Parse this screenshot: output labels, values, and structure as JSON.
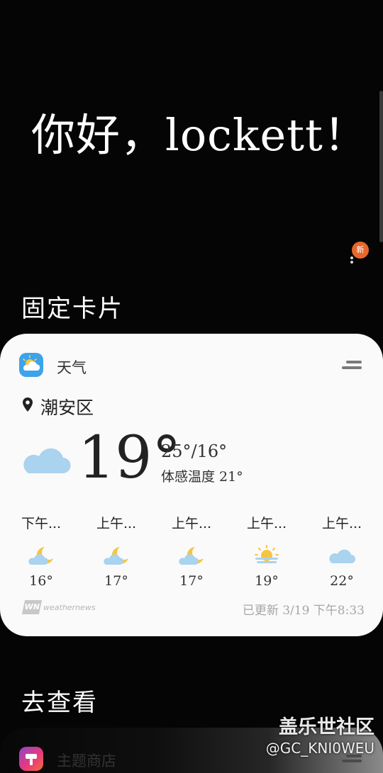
{
  "greeting": "你好，lockett！",
  "menu": {
    "badge": "新",
    "icon": "more-vertical-icon"
  },
  "pinned_section": {
    "title": "固定卡片",
    "weather": {
      "app_name": "天气",
      "app_icon": "weather-app-icon",
      "location": "潮安区",
      "current": {
        "condition": "cloudy",
        "temperature": "19°",
        "range": "25°/16°",
        "feels_like": "体感温度 21°"
      },
      "forecast": [
        {
          "time": "下午...",
          "condition": "cloudy-night",
          "temp": "16°"
        },
        {
          "time": "上午...",
          "condition": "cloudy-night",
          "temp": "17°"
        },
        {
          "time": "上午...",
          "condition": "cloudy-night",
          "temp": "17°"
        },
        {
          "time": "上午...",
          "condition": "cloudy-sun",
          "temp": "19°"
        },
        {
          "time": "上午...",
          "condition": "cloudy",
          "temp": "22°"
        }
      ],
      "provider": "weathernews",
      "provider_mark": "WN",
      "updated": "已更新 3/19 下午8:33"
    }
  },
  "goto_section": {
    "title": "去查看",
    "items": [
      {
        "label": "主题商店",
        "icon": "theme-store-icon"
      }
    ]
  },
  "watermark": {
    "title": "盖乐世社区",
    "handle": "@GC_KNI0WEU"
  },
  "colors": {
    "background": "#050505",
    "card": "#fafafa",
    "badge": "#e9672a",
    "weather_icon_bg": "#3da3ea",
    "cloud": "#a9d3ee",
    "moon": "#f5c542"
  }
}
